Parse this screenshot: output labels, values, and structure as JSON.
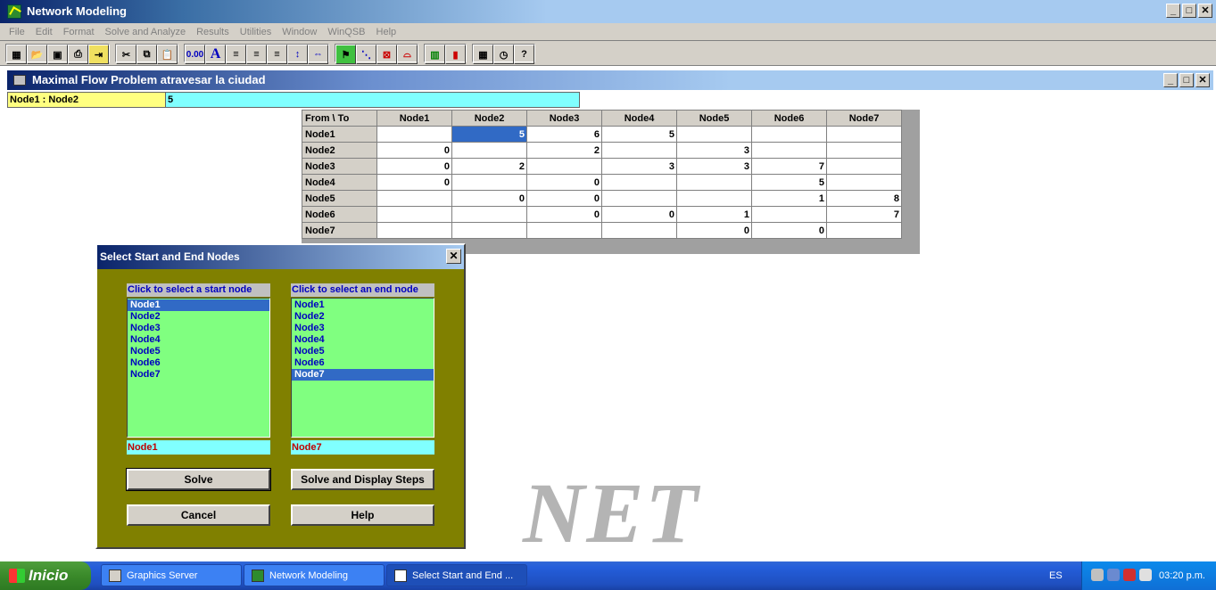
{
  "app": {
    "title": "Network Modeling",
    "menu": [
      "File",
      "Edit",
      "Format",
      "Solve and Analyze",
      "Results",
      "Utilities",
      "Window",
      "WinQSB",
      "Help"
    ]
  },
  "toolbar": {
    "groups": [
      [
        "new-icon",
        "open-icon",
        "save-icon",
        "print-icon",
        "exit-icon"
      ],
      [
        "cut-icon",
        "copy-icon",
        "paste-icon"
      ],
      [
        "number-format-icon",
        "font-icon",
        "align-left-icon",
        "align-center-icon",
        "align-right-icon",
        "row-height-icon",
        "column-width-icon"
      ],
      [
        "solve-icon",
        "graphic-icon",
        "network-icon",
        "chart-icon"
      ],
      [
        "grid-icon",
        "bar-chart-icon"
      ],
      [
        "calculator-icon",
        "clock-icon",
        "help-icon"
      ]
    ],
    "number_format_label": "0.00",
    "font_label": "A",
    "help_label": "?"
  },
  "child_window": {
    "title": "Maximal Flow Problem atravesar la ciudad",
    "cell_ref": "Node1 : Node2",
    "cell_value": "5"
  },
  "grid": {
    "corner": "From \\ To",
    "columns": [
      "Node1",
      "Node2",
      "Node3",
      "Node4",
      "Node5",
      "Node6",
      "Node7"
    ],
    "rows": [
      {
        "label": "Node1",
        "cells": [
          "",
          "5",
          "6",
          "5",
          "",
          "",
          ""
        ]
      },
      {
        "label": "Node2",
        "cells": [
          "0",
          "",
          "2",
          "",
          "3",
          "",
          ""
        ]
      },
      {
        "label": "Node3",
        "cells": [
          "0",
          "2",
          "",
          "3",
          "3",
          "7",
          ""
        ]
      },
      {
        "label": "Node4",
        "cells": [
          "0",
          "",
          "0",
          "",
          "",
          "5",
          ""
        ]
      },
      {
        "label": "Node5",
        "cells": [
          "",
          "0",
          "0",
          "",
          "",
          "1",
          "8"
        ]
      },
      {
        "label": "Node6",
        "cells": [
          "",
          "",
          "0",
          "0",
          "1",
          "",
          "7"
        ]
      },
      {
        "label": "Node7",
        "cells": [
          "",
          "",
          "",
          "",
          "0",
          "0",
          ""
        ]
      }
    ],
    "selected": {
      "row": 0,
      "col": 1
    }
  },
  "watermark": "NET",
  "dialog": {
    "title": "Select Start and End Nodes",
    "start_label": "Click to select a start node",
    "end_label": "Click to select an end node",
    "nodes": [
      "Node1",
      "Node2",
      "Node3",
      "Node4",
      "Node5",
      "Node6",
      "Node7"
    ],
    "start_selected_index": 0,
    "end_selected_index": 6,
    "start_value": "Node1",
    "end_value": "Node7",
    "buttons": {
      "solve": "Solve",
      "solve_steps": "Solve and Display Steps",
      "cancel": "Cancel",
      "help": "Help"
    }
  },
  "taskbar": {
    "start": "Inicio",
    "tasks": [
      {
        "label": "Graphics Server",
        "active": false
      },
      {
        "label": "Network Modeling",
        "active": false
      },
      {
        "label": "Select Start and End ...",
        "active": true
      }
    ],
    "language": "ES",
    "clock": "03:20 p.m."
  }
}
